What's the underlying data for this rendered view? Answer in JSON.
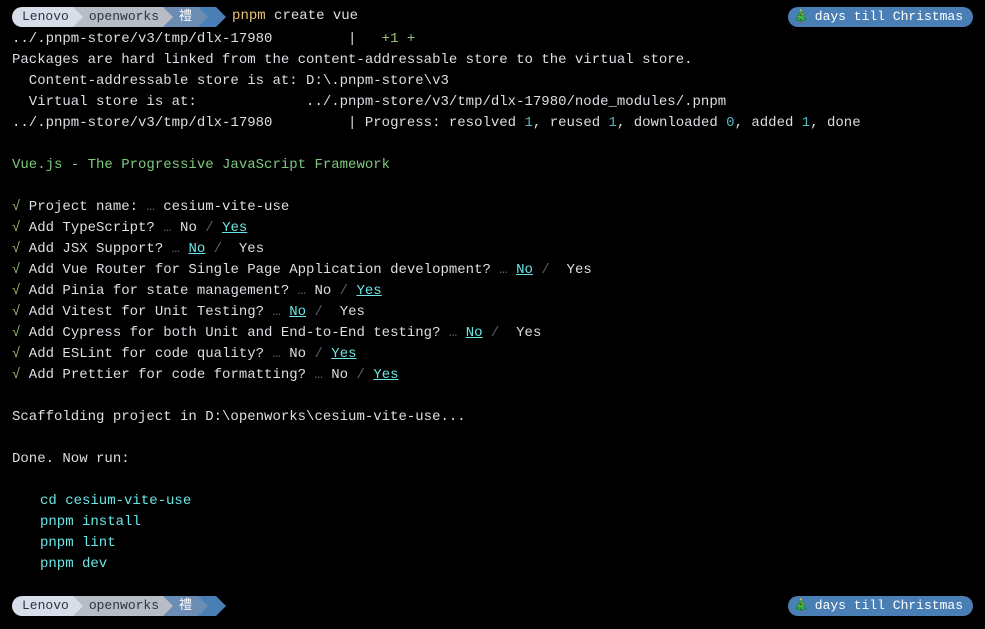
{
  "prompt1": {
    "seg1": "Lenovo",
    "seg2": "openworks",
    "seg3": "禮",
    "cmd_prefix": "pnpm",
    "cmd_rest": " create vue"
  },
  "badge": {
    "tree": "🎄",
    "text": "days till Christmas"
  },
  "out": {
    "l1_path": "../.pnpm-store/v3/tmp/dlx-17980        ",
    "l1_bar": " |   ",
    "l1_plus": "+1 +",
    "l2": "Packages are hard linked from the content-addressable store to the virtual store.",
    "l3": "  Content-addressable store is at: D:\\.pnpm-store\\v3",
    "l4": "  Virtual store is at:             ../.pnpm-store/v3/tmp/dlx-17980/node_modules/.pnpm",
    "l5_path": "../.pnpm-store/v3/tmp/dlx-17980        ",
    "l5_prog": " | Progress: resolved ",
    "l5_r1": "1",
    "l5_c1": ", reused ",
    "l5_r2": "1",
    "l5_c2": ", downloaded ",
    "l5_r3": "0",
    "l5_c3": ", added ",
    "l5_r4": "1",
    "l5_c4": ", done"
  },
  "vue_banner": "Vue.js - The Progressive JavaScript Framework",
  "check": "√",
  "dots": "…",
  "slash": " / ",
  "q": {
    "q1": " Project name: ",
    "a1": " cesium-vite-use",
    "q2": " Add TypeScript? ",
    "q3": " Add JSX Support? ",
    "q4": " Add Vue Router for Single Page Application development? ",
    "q5": " Add Pinia for state management? ",
    "q6": " Add Vitest for Unit Testing? ",
    "q7": " Add Cypress for both Unit and End-to-End testing? ",
    "q8": " Add ESLint for code quality? ",
    "q9": " Add Prettier for code formatting? "
  },
  "noyes": {
    "no_plain": " No",
    "yes_plain": " Yes",
    "no_sel": "No",
    "yes_sel": "Yes"
  },
  "scaffold": "Scaffolding project in D:\\openworks\\cesium-vite-use...",
  "done": "Done. Now run:",
  "cmds": {
    "c1": "cd cesium-vite-use",
    "c2": "pnpm install",
    "c3": "pnpm lint",
    "c4": "pnpm dev"
  },
  "prompt2": {
    "seg1": "Lenovo",
    "seg2": "openworks",
    "seg3": "禮"
  }
}
